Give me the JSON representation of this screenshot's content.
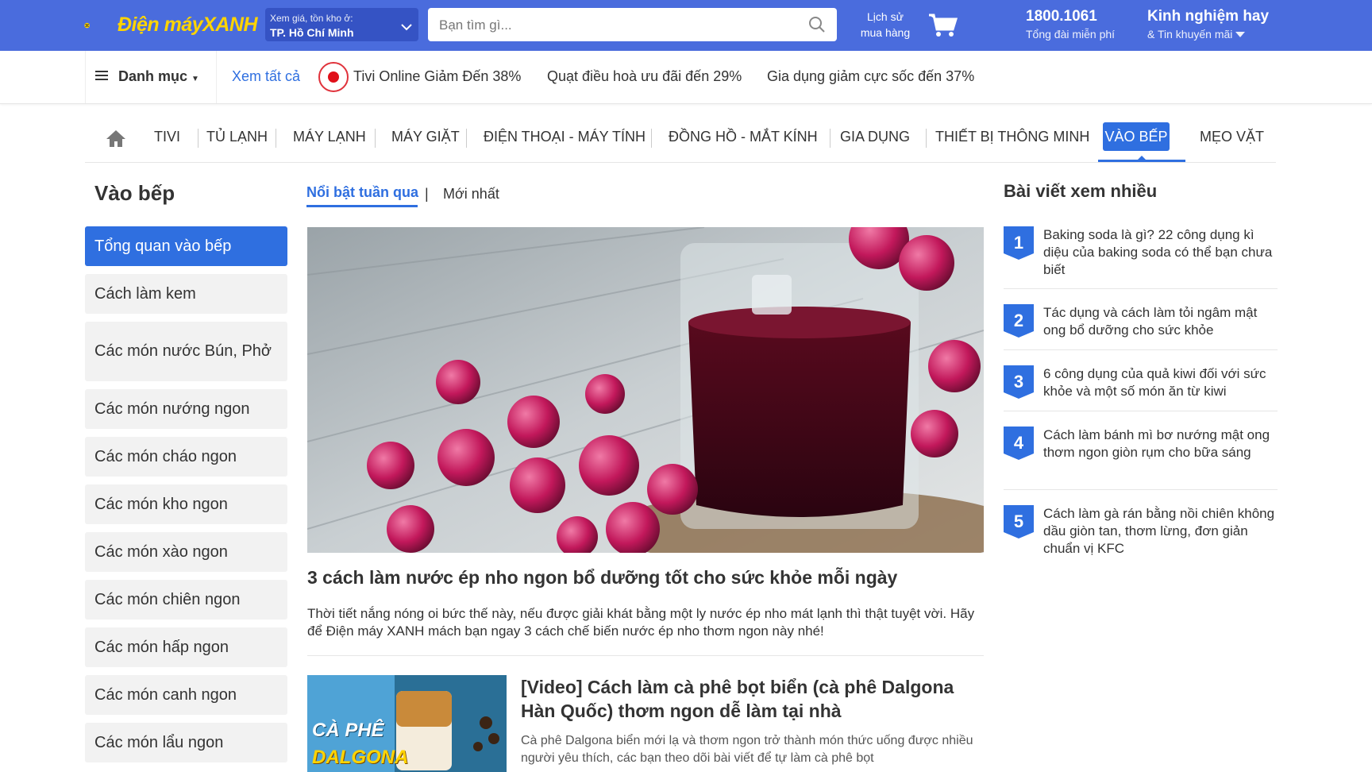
{
  "brand": {
    "logo_text_a": "Điện máy",
    "logo_text_b": "XANH"
  },
  "location": {
    "caption": "Xem giá, tồn kho ở:",
    "value": "TP. Hồ Chí Minh"
  },
  "search": {
    "placeholder": "Bạn tìm gì..."
  },
  "header": {
    "history_line1": "Lịch sử",
    "history_line2": "mua hàng",
    "hotline_number": "1800.1061",
    "hotline_sub": "Tổng đài miễn phí",
    "experience_title": "Kinh nghiệm hay",
    "experience_sub": "& Tin khuyến mãi"
  },
  "subbar": {
    "menu_label": "Danh mục",
    "see_all": "Xem tất cả",
    "promos": [
      "Tivi Online Giảm Đến 38%",
      "Quạt điều hoà ưu đãi đến 29%",
      "Gia dụng giảm cực sốc đến 37%"
    ]
  },
  "nav": {
    "items": [
      "TIVI",
      "TỦ LẠNH",
      "MÁY LẠNH",
      "MÁY GIẶT",
      "ĐIỆN THOẠI - MÁY TÍNH",
      "ĐỒNG HỒ - MẮT KÍNH",
      "GIA DỤNG",
      "THIẾT BỊ THÔNG MINH",
      "VÀO BẾP",
      "MẸO VẶT"
    ],
    "active": "VÀO BẾP"
  },
  "sidebar": {
    "title": "Vào bếp",
    "items": [
      "Tổng quan vào bếp",
      "Cách làm kem",
      "Các món nước Bún, Phở",
      "Các món nướng ngon",
      "Các món cháo ngon",
      "Các món kho ngon",
      "Các món xào ngon",
      "Các món chiên ngon",
      "Các món hấp ngon",
      "Các món canh ngon",
      "Các món lẩu ngon"
    ]
  },
  "tabs": {
    "featured": "Nổi bật tuần qua",
    "separator": "|",
    "latest": "Mới nhất"
  },
  "main_article": {
    "title": "3 cách làm nước ép nho ngon bổ dưỡng tốt cho sức khỏe mỗi ngày",
    "summary": "Thời tiết nắng nóng oi bức thế này, nếu được giải khát bằng một ly nước ép nho mát lạnh thì thật tuyệt vời. Hãy để Điện máy XANH mách bạn ngay 3 cách chế biến nước ép nho thơm ngon này nhé!"
  },
  "second_article": {
    "thumb_text_a": "CÀ PHÊ",
    "thumb_text_b": "DALGONA",
    "title": "[Video] Cách làm cà phê bọt biển (cà phê Dalgona Hàn Quốc) thơm ngon dễ làm tại nhà",
    "summary": "Cà phê Dalgona biển mới lạ và thơm ngon trở thành món thức uống được nhiều người yêu thích, các bạn theo dõi bài viết để tự làm cà phê bọt"
  },
  "popular": {
    "title": "Bài viết xem nhiều",
    "items": [
      {
        "rank": "1",
        "text": "Baking soda là gì? 22 công dụng kì diệu của baking soda có thể bạn chưa biết"
      },
      {
        "rank": "2",
        "text": "Tác dụng và cách làm tỏi ngâm mật ong bổ dưỡng cho sức khỏe"
      },
      {
        "rank": "3",
        "text": "6 công dụng của quả kiwi đối với sức khỏe và một số món ăn từ kiwi"
      },
      {
        "rank": "4",
        "text": "Cách làm bánh mì bơ nướng mật ong thơm ngon giòn rụm cho bữa sáng"
      },
      {
        "rank": "5",
        "text": "Cách làm gà rán bằng nồi chiên không dầu giòn tan, thơm lừng, đơn giản chuẩn vị KFC"
      }
    ]
  },
  "colors": {
    "primary": "#4a6cdd",
    "accent_blue": "#2f6fe0",
    "logo_yellow": "#ffd400",
    "live_red": "#e0101a"
  },
  "icons": [
    "logo-icon",
    "chevron-down-icon",
    "search-icon",
    "cart-icon",
    "menu-icon",
    "live-icon",
    "home-icon"
  ]
}
